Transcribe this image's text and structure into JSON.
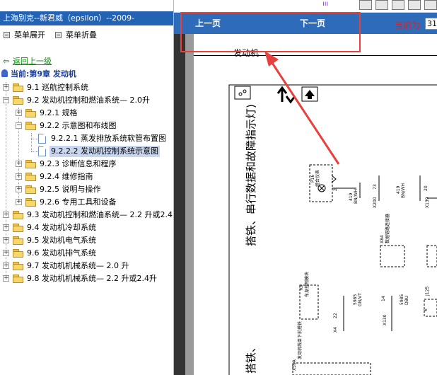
{
  "app": {
    "title": "上海别克--新君威（epsilon）--2009-"
  },
  "menu": {
    "expand_label": "菜单展开",
    "collapse_label": "菜单折叠"
  },
  "toc": {
    "back_label": "返回上一级",
    "current_label": "当前:第9章 发动机",
    "items": [
      {
        "label": "9.1 巡航控制系统",
        "icon": "folder-icon"
      },
      {
        "label": "9.2 发动机控制和燃油系统— 2.0升",
        "icon": "folder-open-icon"
      },
      {
        "label": "9.2.1 规格",
        "icon": "folder-icon"
      },
      {
        "label": "9.2.2 示意图和布线图",
        "icon": "folder-open-icon"
      },
      {
        "label": "9.2.2.1 蒸发排放系统软管布置图",
        "icon": "document-icon"
      },
      {
        "label": "9.2.2.2 发动机控制系统示意图",
        "icon": "document-icon",
        "selected": true
      },
      {
        "label": "9.2.3 诊断信息和程序",
        "icon": "folder-icon"
      },
      {
        "label": "9.2.4 维修指南",
        "icon": "folder-icon"
      },
      {
        "label": "9.2.5 说明与操作",
        "icon": "folder-icon"
      },
      {
        "label": "9.2.6 专用工具和设备",
        "icon": "folder-icon"
      },
      {
        "label": "9.3 发动机控制和燃油系统— 2.2 升或2.4",
        "icon": "folder-icon"
      },
      {
        "label": "9.4 发动机冷却系统",
        "icon": "folder-icon"
      },
      {
        "label": "9.5 发动机电气系统",
        "icon": "folder-icon"
      },
      {
        "label": "9.6 发动机排气系统",
        "icon": "folder-icon"
      },
      {
        "label": "9.7 发动机机械系统— 2.0 升",
        "icon": "folder-icon"
      },
      {
        "label": "9.8 发动机机械系统— 2.2 升或2.4升",
        "icon": "folder-icon"
      }
    ]
  },
  "viewer": {
    "prev_label": "上一页",
    "next_label": "下一页",
    "current_page_label": "当前为",
    "current_page_value": "31",
    "page_heading": "发动机",
    "diagram_title": "搭铁、串行数据和故障指示灯)",
    "diagram_labels": {
      "p16": "P16",
      "p16_name": "组合仪表",
      "x200": "X200",
      "x139": "X139",
      "x84": "X84",
      "x84_name": "数据链路连接器",
      "k9": "K9",
      "k9_name": "车身控制模块",
      "x4": "X4",
      "x130": "X130",
      "x59a": "X59A",
      "x59a_name": "发动机线束下前搭铁",
      "w1": "419",
      "w1b": "BN/WH",
      "w2": "73",
      "w3": "419",
      "w3b": "BN/WH",
      "w4": "20",
      "p1": "2",
      "p2": "5",
      "w5": "5985",
      "w5b": "GN/VT",
      "w6": "14",
      "w7": "5985",
      "w7b": "DBU",
      "w8": "J125",
      "w9": "22",
      "w10": "6"
    }
  },
  "colors": {
    "title_bar": "#2462b4",
    "viewer_bar": "#2e6bb8",
    "highlight": "#e8403c",
    "back_link": "#0b8a0b",
    "current_chapter": "#1a3c9c"
  }
}
